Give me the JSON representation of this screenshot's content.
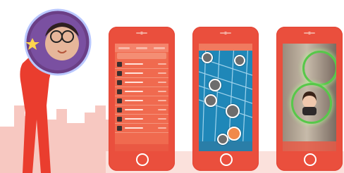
{
  "colors": {
    "brand_red": "#ea4f3d",
    "skyline": "#f6c4bd",
    "map_water": "#1f87b8",
    "bubble_ring": "#57c84a"
  },
  "icons": [
    "star-icon",
    "home-button-icon"
  ],
  "phones": [
    {
      "screen": "user-list",
      "rows": 8
    },
    {
      "screen": "map-view",
      "bubbles": 7
    },
    {
      "screen": "camera-view",
      "rings": 2
    }
  ]
}
